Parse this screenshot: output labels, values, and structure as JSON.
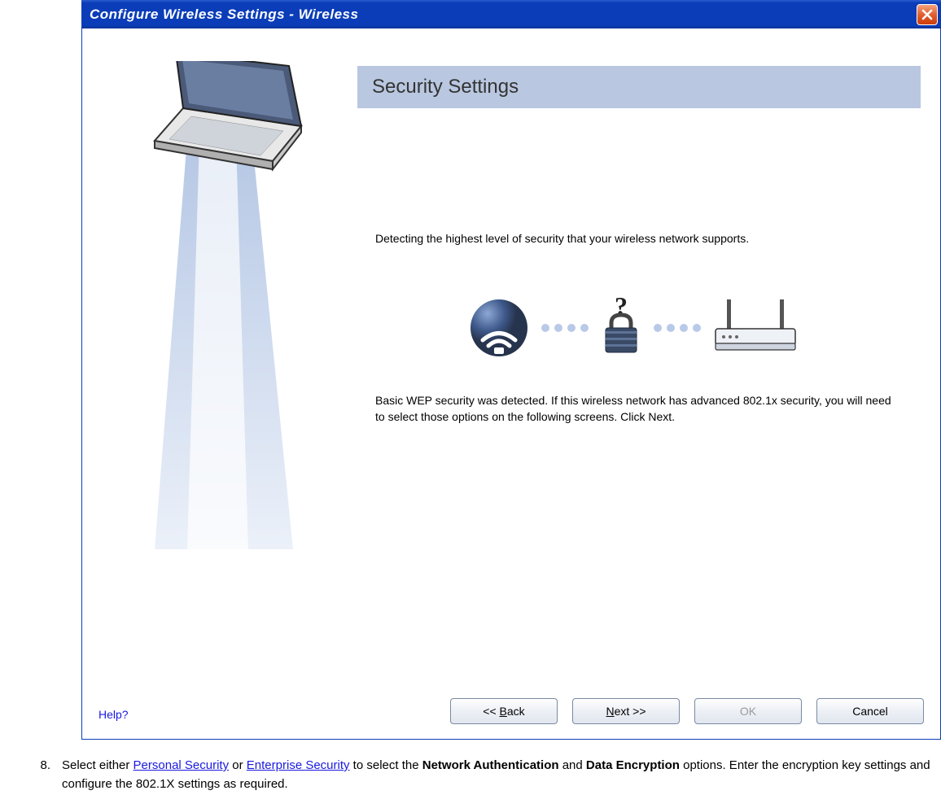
{
  "window": {
    "title": "Configure Wireless Settings  -  Wireless"
  },
  "content": {
    "heading": "Security Settings",
    "detecting_text": "Detecting the highest level of security that your wireless network supports.",
    "result_text": "Basic WEP security was detected. If this wireless network has advanced 802.1x security, you will need to select those options on the following screens. Click Next."
  },
  "footer": {
    "help_label": "Help?",
    "back_label_prefix": "<< ",
    "back_label_accesskey": "B",
    "back_label_suffix": "ack",
    "next_label_accesskey": "N",
    "next_label_suffix": "ext >>",
    "ok_label": "OK",
    "cancel_label": "Cancel"
  },
  "instruction": {
    "number": "8.",
    "text_parts": {
      "t1": "Select either ",
      "link1": "Personal Security",
      "t2": " or ",
      "link2": "Enterprise Security",
      "t3": " to select the ",
      "bold1": "Network Authentication",
      "t4": " and ",
      "bold2": "Data Encryption",
      "t5": " options. Enter the encryption key settings and configure the 802.1X settings as required."
    }
  }
}
